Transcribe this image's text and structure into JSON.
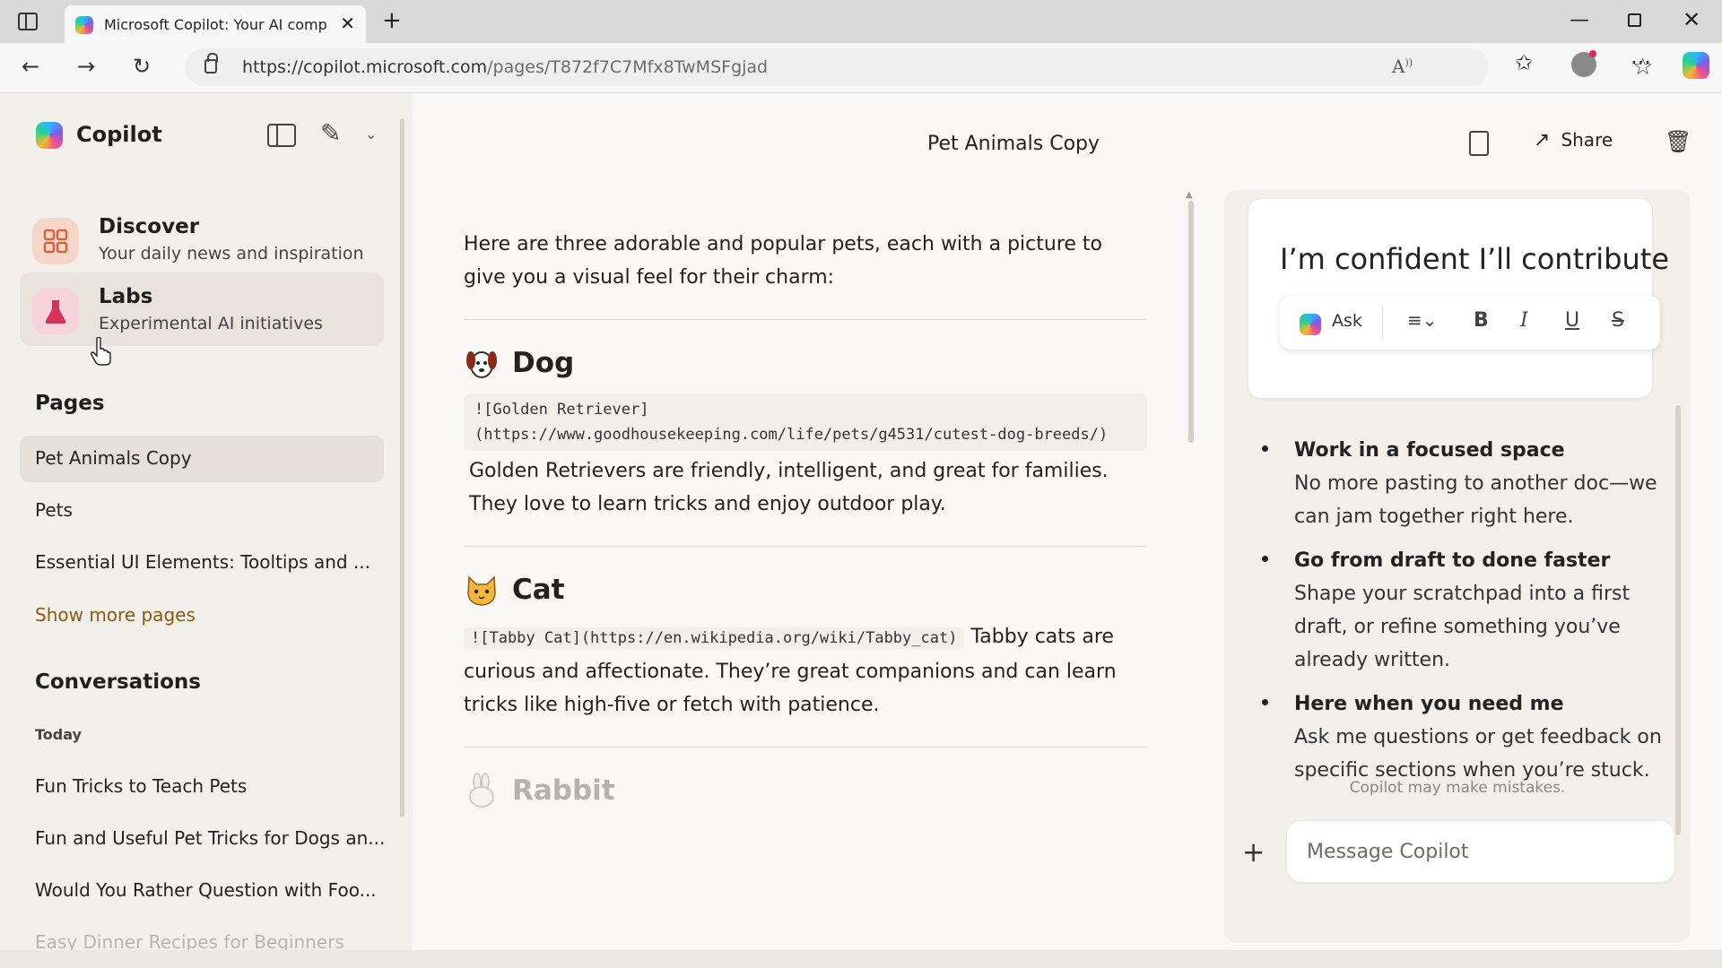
{
  "browser": {
    "tab_title": "Microsoft Copilot: Your AI compa",
    "url_host": "https://copilot.microsoft.com",
    "url_path": "/pages/T872f7C7Mfx8TwMSFgjad"
  },
  "sidebar": {
    "app_name": "Copilot",
    "discover": {
      "title": "Discover",
      "subtitle": "Your daily news and inspiration"
    },
    "labs": {
      "title": "Labs",
      "subtitle": "Experimental AI initiatives"
    },
    "pages_title": "Pages",
    "pages": [
      "Pet Animals Copy",
      "Pets",
      "Essential UI Elements: Tooltips and ..."
    ],
    "show_more": "Show more pages",
    "conversations_title": "Conversations",
    "today_label": "Today",
    "conversations": [
      "Fun Tricks to Teach Pets",
      "Fun and Useful Pet Tricks for Dogs an...",
      "Would You Rather Question with Foo...",
      "Easy Dinner Recipes for Beginners"
    ]
  },
  "header": {
    "page_title": "Pet Animals Copy",
    "share_label": "Share"
  },
  "document": {
    "intro": "Here are three adorable and popular pets, each with a picture to give you a visual feel for their charm:",
    "dog": {
      "heading": "Dog",
      "code": "![Golden Retriever](https://www.goodhousekeeping.com/life/pets/g4531/cutest-dog-breeds/)",
      "text": "Golden Retrievers are friendly, intelligent, and great for families. They love to learn tricks and enjoy outdoor play."
    },
    "cat": {
      "heading": "Cat",
      "code": "![Tabby Cat](https://en.wikipedia.org/wiki/Tabby_cat)",
      "text_inline": "Tabby",
      "text": "cats are curious and affectionate. They’re great companions and can learn tricks like high-five or fetch with patience."
    },
    "rabbit": {
      "heading": "Rabbit"
    }
  },
  "copilot_panel": {
    "draft_text": "I’m confident I’ll contribute",
    "ask_label": "Ask",
    "bullets": [
      {
        "title": "Work in a focused space",
        "body": "No more pasting to another doc—we can jam together right here."
      },
      {
        "title": "Go from draft to done faster",
        "body": "Shape your scratchpad into a first draft, or refine something you’ve already written."
      },
      {
        "title": "Here when you need me",
        "body": "Ask me questions or get feedback on specific sections when you’re stuck."
      }
    ],
    "disclaimer": "Copilot may make mistakes.",
    "message_placeholder": "Message Copilot"
  },
  "colors": {
    "accent_link": "#8a5a14",
    "discover_icon_bg": "#f6d6c8",
    "labs_icon_bg": "#f7d3dc"
  },
  "icons": {
    "discover": "grid-icon",
    "labs": "flask-icon",
    "dog": "dog-face-icon",
    "cat": "cat-face-icon",
    "rabbit": "rabbit-icon"
  }
}
